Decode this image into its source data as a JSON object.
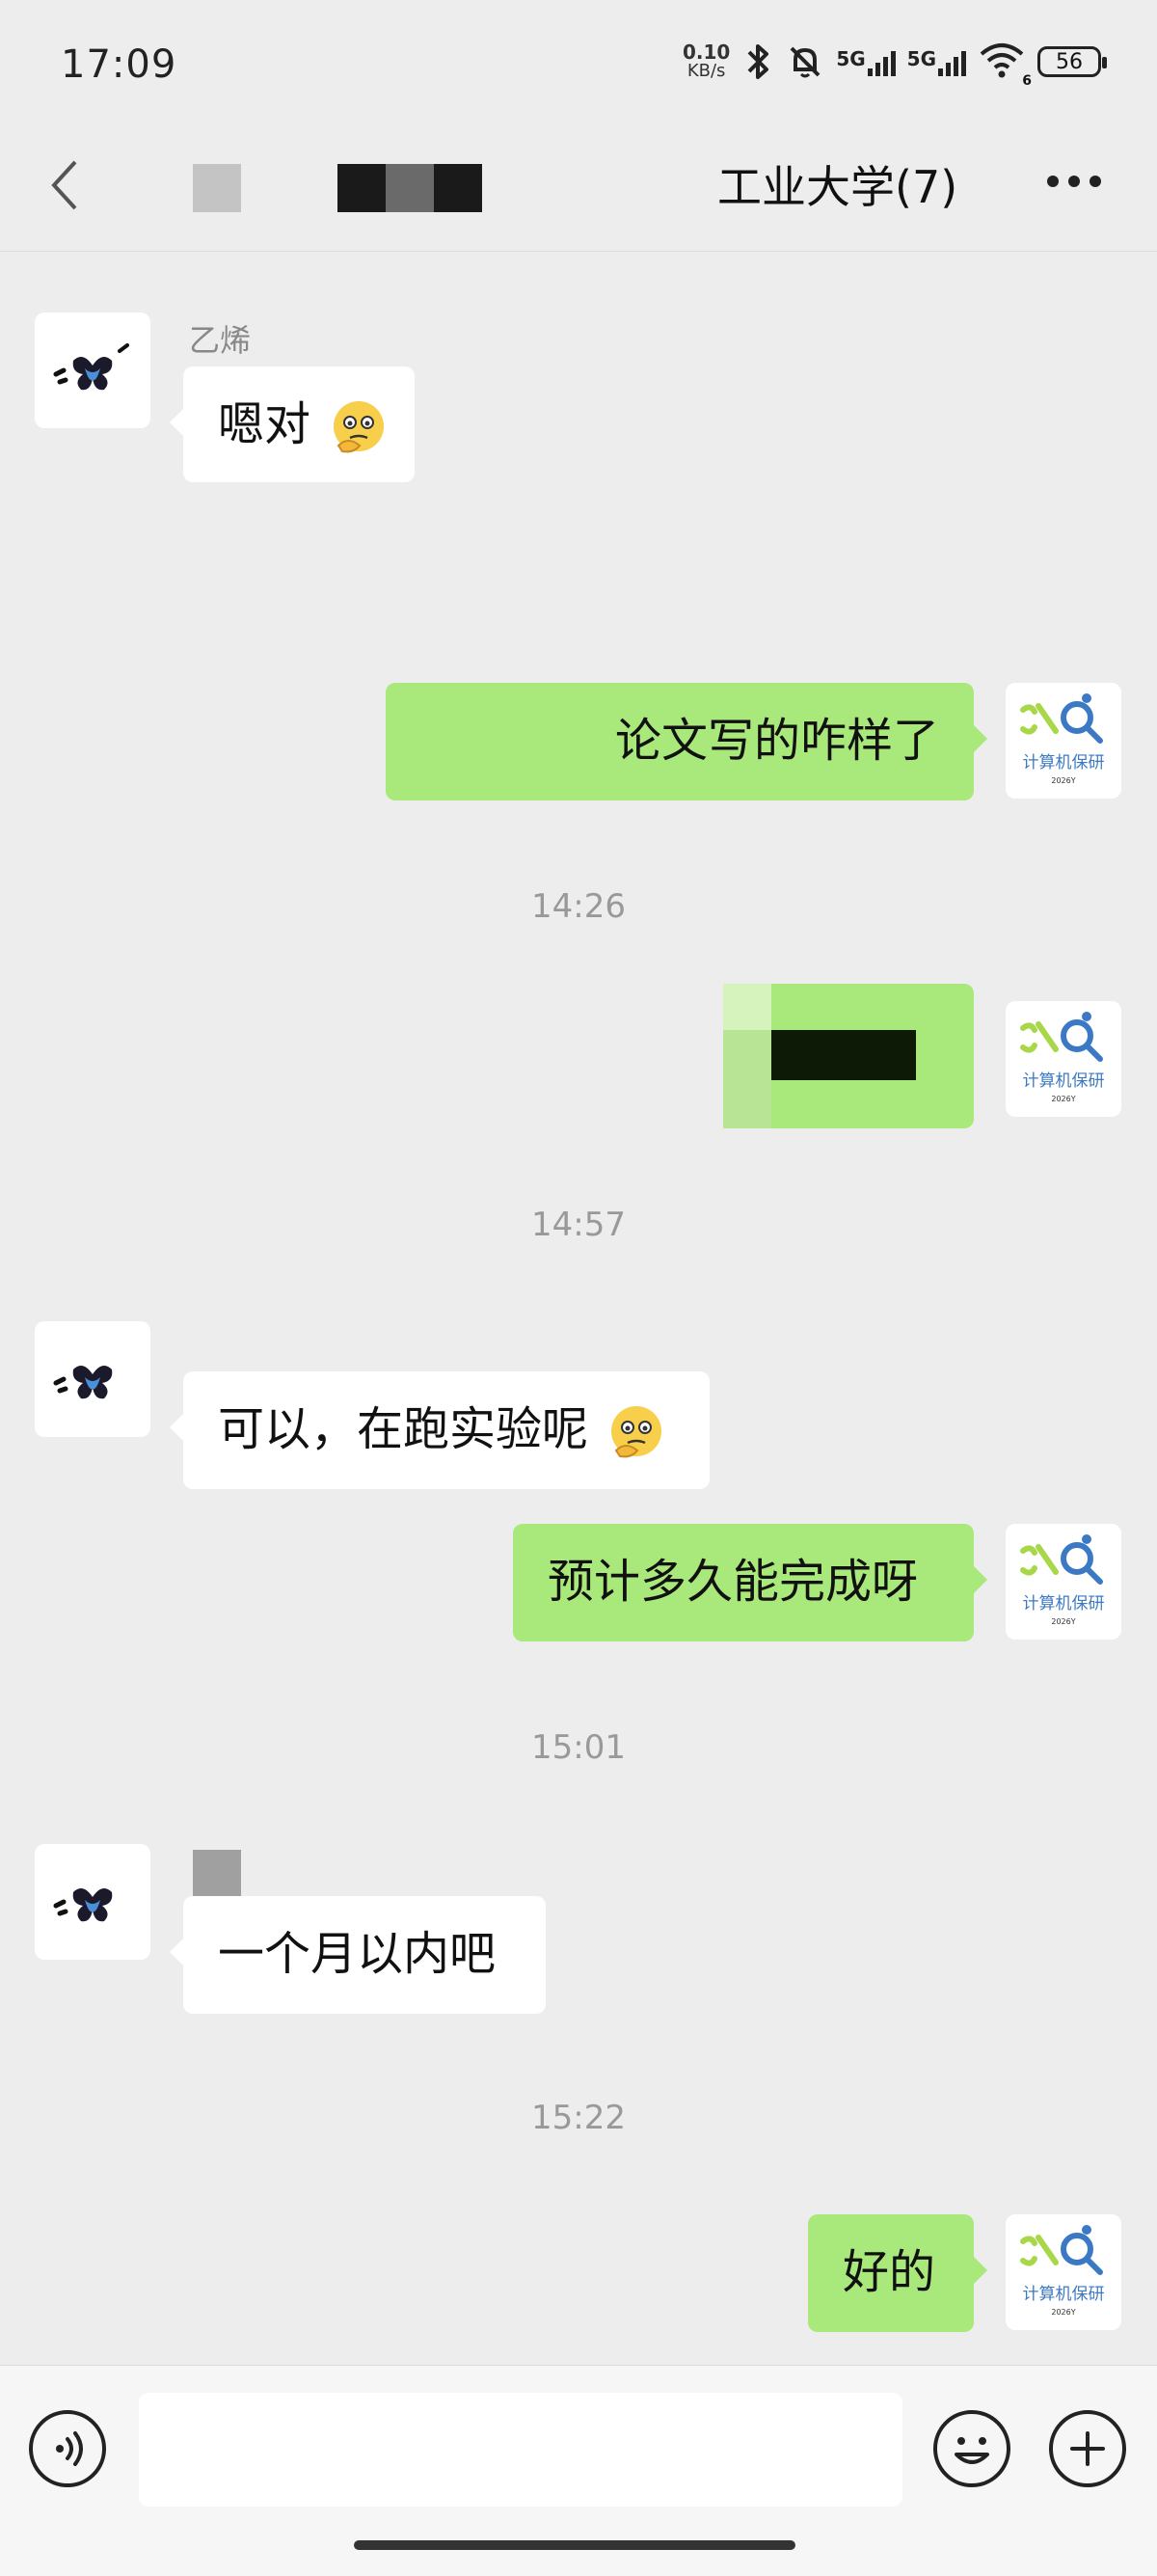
{
  "status_bar": {
    "time": "17:09",
    "net_speed_value": "0.10",
    "net_speed_unit": "KB/s",
    "sim1": "5G",
    "sim2": "5G",
    "wifi_sub": "6",
    "battery": "56",
    "icons": [
      "bluetooth-icon",
      "mute-bell-icon",
      "signal-icon",
      "wifi-icon",
      "battery-icon"
    ]
  },
  "nav": {
    "title": "工业大学(7)",
    "back_icon": "chevron-left-icon",
    "more_icon": "more-dots-icon"
  },
  "messages": [
    {
      "side": "in",
      "sender": "乙烯",
      "text": "嗯对",
      "emoji": "thinking-emoji"
    },
    {
      "side": "out",
      "text": "论文写的咋样了"
    },
    {
      "timestamp": "14:26"
    },
    {
      "side": "out",
      "text": "",
      "redacted": true
    },
    {
      "timestamp": "14:57"
    },
    {
      "side": "in",
      "text": "可以，在跑实验呢",
      "emoji": "thinking-emoji"
    },
    {
      "side": "out",
      "text": "预计多久能完成呀"
    },
    {
      "timestamp": "15:01"
    },
    {
      "side": "in",
      "text": "一个月以内吧"
    },
    {
      "timestamp": "15:22"
    },
    {
      "side": "out",
      "text": "好的"
    }
  ],
  "self_avatar": {
    "caption": "计算机保研",
    "year": "2026Y"
  },
  "input_bar": {
    "voice_icon": "voice-icon",
    "emoji_icon": "emoji-icon",
    "plus_icon": "plus-icon"
  },
  "colors": {
    "background": "#ededed",
    "outgoing_bubble": "#a9e87a",
    "incoming_bubble": "#ffffff"
  }
}
